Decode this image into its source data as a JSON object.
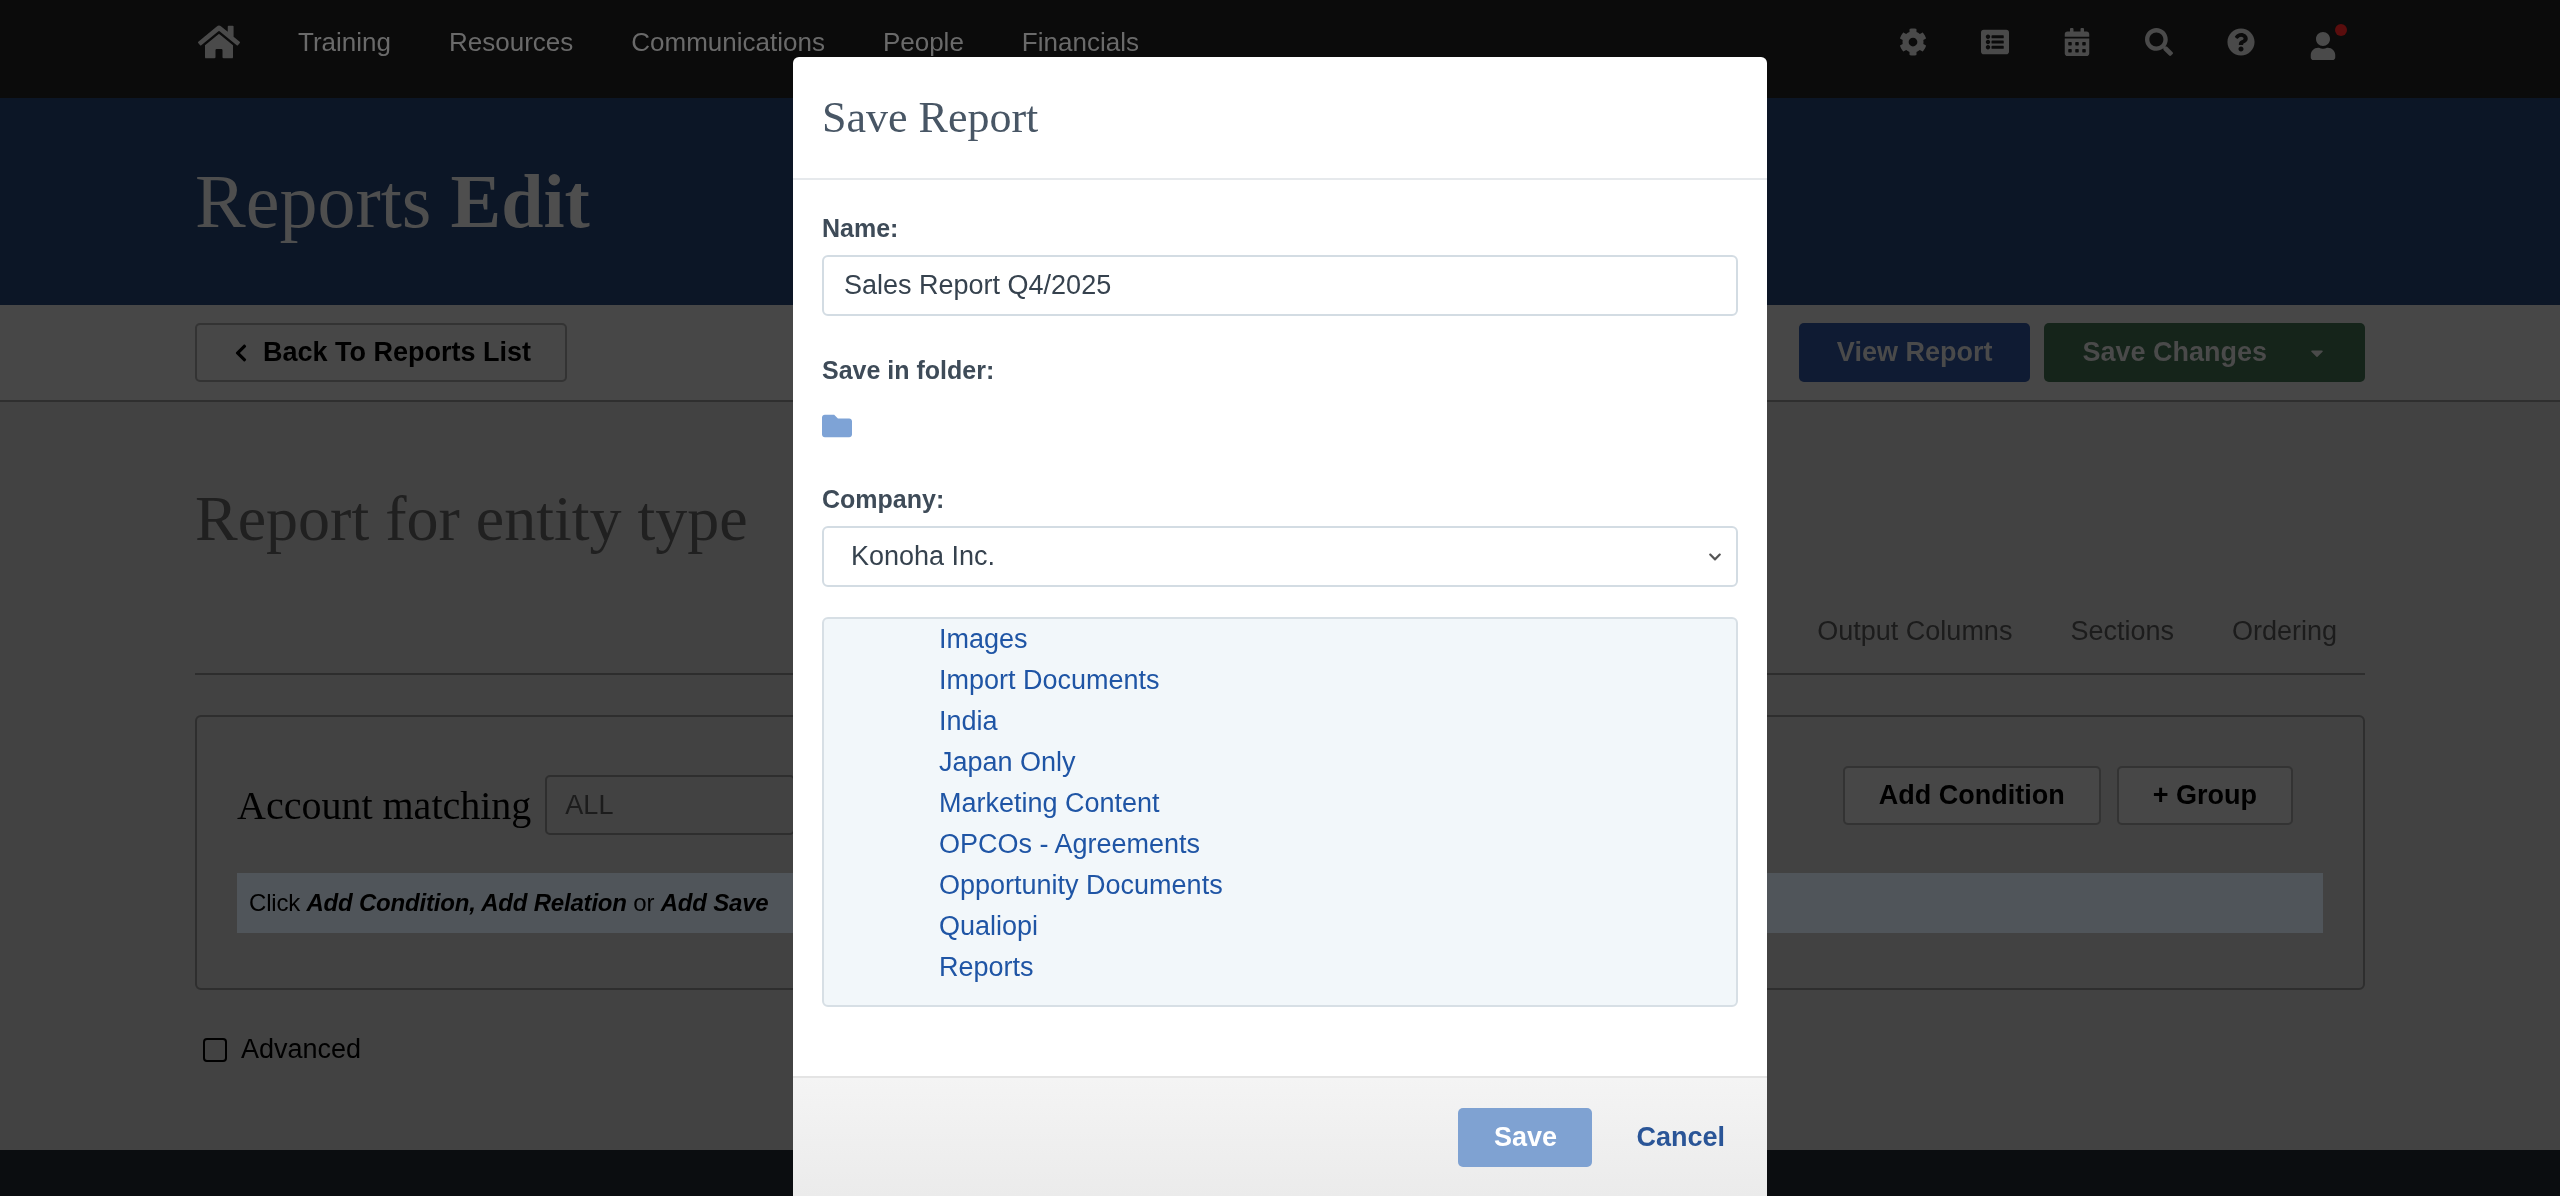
{
  "nav": {
    "items": [
      {
        "label": "Training"
      },
      {
        "label": "Resources"
      },
      {
        "label": "Communications"
      },
      {
        "label": "People"
      },
      {
        "label": "Financials"
      }
    ]
  },
  "header": {
    "title": "Reports **Edit**"
  },
  "toolbar": {
    "back_button": "Back To Reports List",
    "view_button": "View Report",
    "save_button": "Save Changes"
  },
  "page_title": "Report for entity type",
  "tabs": [
    {
      "label": "Output Columns",
      "selected": false
    },
    {
      "label": "Sections",
      "selected": false
    },
    {
      "label": "Ordering",
      "selected": false
    }
  ],
  "conditions": {
    "label": "Account matching",
    "match_select": "ALL",
    "buttons": [
      "Add Condition",
      "+ Group"
    ],
    "hint": [
      {
        "text": "Click ",
        "emphasis": false
      },
      {
        "text": "Add Condition, Add Relation",
        "emphasis": true
      },
      {
        "text": " or ",
        "emphasis": false
      },
      {
        "text": "Add Save",
        "emphasis": true
      }
    ]
  },
  "advanced": {
    "label": "Advanced",
    "checked": false
  },
  "dialog": {
    "title": "Save Report",
    "name_label": "Name:",
    "name_value": "Sales Report Q4/2025",
    "folder_label": "Save in folder:",
    "company_label": "Company:",
    "company_value": "Konoha Inc.",
    "folders": [
      {
        "label": "Images",
        "selected": false
      },
      {
        "label": "Import Documents",
        "selected": false
      },
      {
        "label": "India",
        "selected": false
      },
      {
        "label": "Japan Only",
        "selected": false
      },
      {
        "label": "Marketing Content",
        "selected": false
      },
      {
        "label": "OPCOs - Agreements",
        "selected": false
      },
      {
        "label": "Opportunity Documents",
        "selected": false
      },
      {
        "label": "Qualiopi",
        "selected": false
      },
      {
        "label": "Reports",
        "selected": false
      }
    ],
    "save_button": "Save",
    "save_disabled": true,
    "cancel_button": "Cancel"
  }
}
